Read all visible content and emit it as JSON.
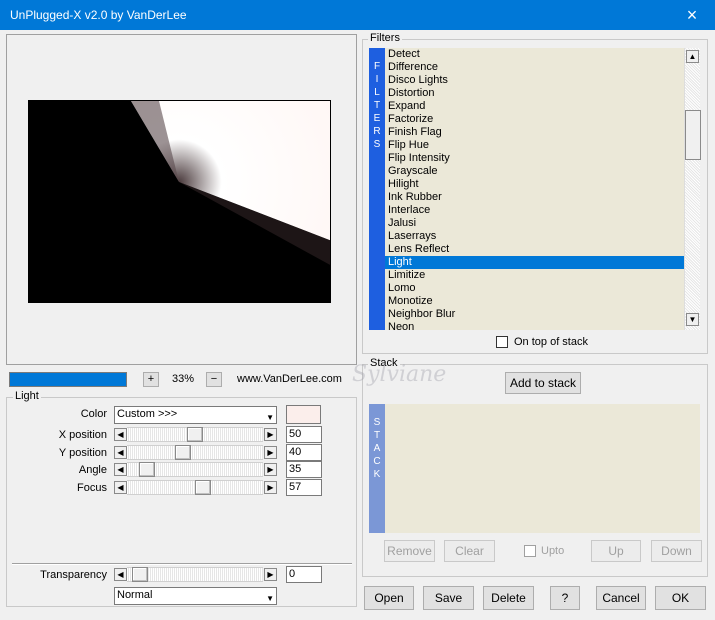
{
  "window": {
    "title": "UnPlugged-X v2.0 by VanDerLee",
    "close_icon": "×"
  },
  "preview": {
    "zoom_value": "33%",
    "zoom_plus": "+",
    "zoom_minus": "−",
    "website": "www.VanDerLee.com",
    "progress_fraction": 1.0
  },
  "light": {
    "group_label": "Light",
    "color_label": "Color",
    "color_value": "Custom >>>",
    "color_swatch": "#fbeeeb",
    "params": [
      {
        "label": "X position",
        "value": "50",
        "slider": 0.5
      },
      {
        "label": "Y position",
        "value": "40",
        "slider": 0.4
      },
      {
        "label": "Angle",
        "value": "35",
        "slider": 0.1
      },
      {
        "label": "Focus",
        "value": "57",
        "slider": 0.57
      }
    ],
    "transparency_label": "Transparency",
    "transparency_value": "0",
    "blend_mode": "Normal"
  },
  "filters": {
    "group_label": "Filters",
    "strip_text": [
      "F",
      "I",
      "L",
      "T",
      "E",
      "R",
      "S"
    ],
    "items": [
      "Detect",
      "Difference",
      "Disco Lights",
      "Distortion",
      "Expand",
      "Factorize",
      "Finish Flag",
      "Flip Hue",
      "Flip Intensity",
      "Grayscale",
      "Hilight",
      "Ink Rubber",
      "Interlace",
      "Jalusi",
      "Laserrays",
      "Lens Reflect",
      "Light",
      "Limitize",
      "Lomo",
      "Monotize",
      "Neighbor Blur",
      "Neon"
    ],
    "selected": "Light",
    "on_top_label": "On top of stack"
  },
  "stack": {
    "group_label": "Stack",
    "add_button": "Add to stack",
    "strip_text": [
      "S",
      "T",
      "A",
      "C",
      "K"
    ],
    "remove": "Remove",
    "clear": "Clear",
    "upto": "Upto",
    "up": "Up",
    "down": "Down"
  },
  "footer": {
    "open": "Open",
    "save": "Save",
    "delete": "Delete",
    "help": "?",
    "cancel": "Cancel",
    "ok": "OK"
  },
  "watermark": "Sylviane"
}
